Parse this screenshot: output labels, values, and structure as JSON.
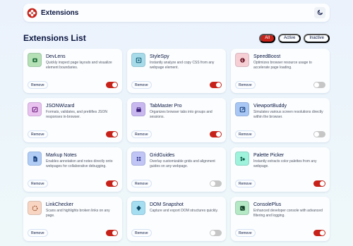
{
  "header": {
    "brand_name": "Extensions",
    "logo_icon": "extensions-logo-icon",
    "theme_icon": "moon-icon"
  },
  "main": {
    "title": "Extensions List",
    "filters": [
      {
        "label": "All",
        "active": true
      },
      {
        "label": "Active",
        "active": false
      },
      {
        "label": "Inactive",
        "active": false
      }
    ]
  },
  "colors": {
    "accent": "#c7221a",
    "text": "#091540",
    "toggle_off": "#c6c6c6"
  },
  "remove_label": "Remove",
  "extensions": [
    {
      "name": "DevLens",
      "desc": "Quickly inspect page layouts and visualize element boundaries.",
      "enabled": true,
      "icon": "devlens-icon",
      "icon_bg": "#b5dfb5"
    },
    {
      "name": "StyleSpy",
      "desc": "Instantly analyze and copy CSS from any webpage element.",
      "enabled": true,
      "icon": "stylespy-icon",
      "icon_bg": "#a8dbe9"
    },
    {
      "name": "SpeedBoost",
      "desc": "Optimizes browser resource usage to accelerate page loading.",
      "enabled": false,
      "icon": "speedboost-icon",
      "icon_bg": "#f6cfd5"
    },
    {
      "name": "JSONWizard",
      "desc": "Formats, validates, and prettifies JSON responses in-browser.",
      "enabled": true,
      "icon": "jsonwizard-icon",
      "icon_bg": "#e9c2ef"
    },
    {
      "name": "TabMaster Pro",
      "desc": "Organizes browser tabs into groups and sessions.",
      "enabled": true,
      "icon": "tabmaster-icon",
      "icon_bg": "#c9b8ef"
    },
    {
      "name": "ViewportBuddy",
      "desc": "Simulates various screen resolutions directly within the browser.",
      "enabled": false,
      "icon": "viewportbuddy-icon",
      "icon_bg": "#a9c7f4"
    },
    {
      "name": "Markup Notes",
      "desc": "Enables annotation and notes directly onto webpages for collaborative debugging.",
      "enabled": true,
      "icon": "markup-notes-icon",
      "icon_bg": "#b1cdf5"
    },
    {
      "name": "GridGuides",
      "desc": "Overlay customizable grids and alignment guides on any webpage.",
      "enabled": false,
      "icon": "gridguides-icon",
      "icon_bg": "#c0c5f5"
    },
    {
      "name": "Palette Picker",
      "desc": "Instantly extracts color palettes from any webpage.",
      "enabled": true,
      "icon": "palette-picker-icon",
      "icon_bg": "#9ff2dc"
    },
    {
      "name": "LinkChecker",
      "desc": "Scans and highlights broken links on any page.",
      "enabled": true,
      "icon": "linkchecker-icon",
      "icon_bg": "#f8d5c2"
    },
    {
      "name": "DOM Snapshot",
      "desc": "Capture and export DOM structures quickly.",
      "enabled": false,
      "icon": "dom-snapshot-icon",
      "icon_bg": "#a5def1"
    },
    {
      "name": "ConsolePlus",
      "desc": "Enhanced developer console with advanced filtering and logging.",
      "enabled": true,
      "icon": "consoleplus-icon",
      "icon_bg": "#b5e8c4"
    }
  ]
}
